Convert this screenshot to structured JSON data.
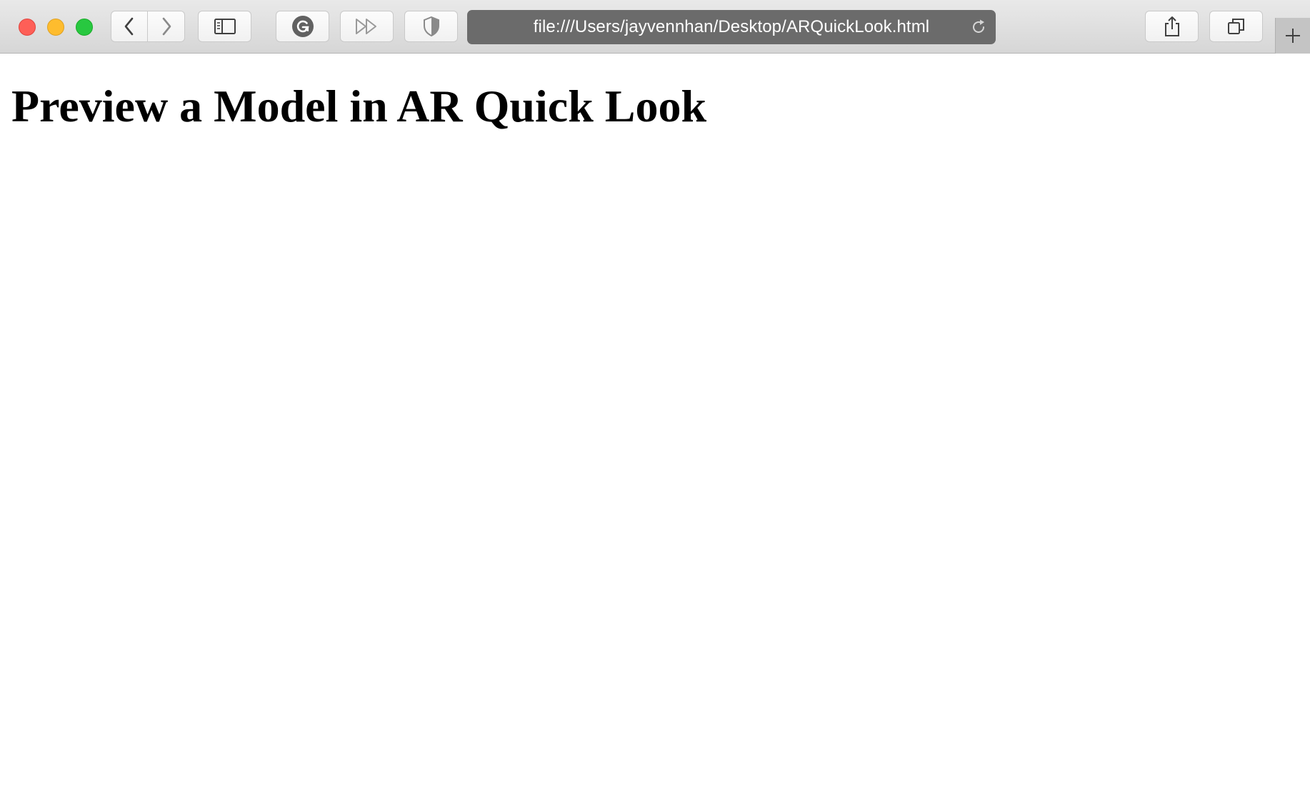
{
  "browser": {
    "address_url": "file:///Users/jayvennhan/Desktop/ARQuickLook.html",
    "icons": {
      "back": "chevron-left-icon",
      "forward": "chevron-right-icon",
      "sidebar": "sidebar-icon",
      "grammarly": "grammarly-extension-icon",
      "fast_forward": "fast-forward-icon",
      "shield": "shield-icon",
      "reload": "reload-icon",
      "share": "share-icon",
      "tabs": "tabs-overview-icon",
      "new_tab": "plus-icon"
    },
    "colors": {
      "close": "#fe5f57",
      "minimize": "#febc2e",
      "maximize": "#28c840",
      "address_bar": "#6b6b6b"
    }
  },
  "page": {
    "heading": "Preview a Model in AR Quick Look"
  }
}
